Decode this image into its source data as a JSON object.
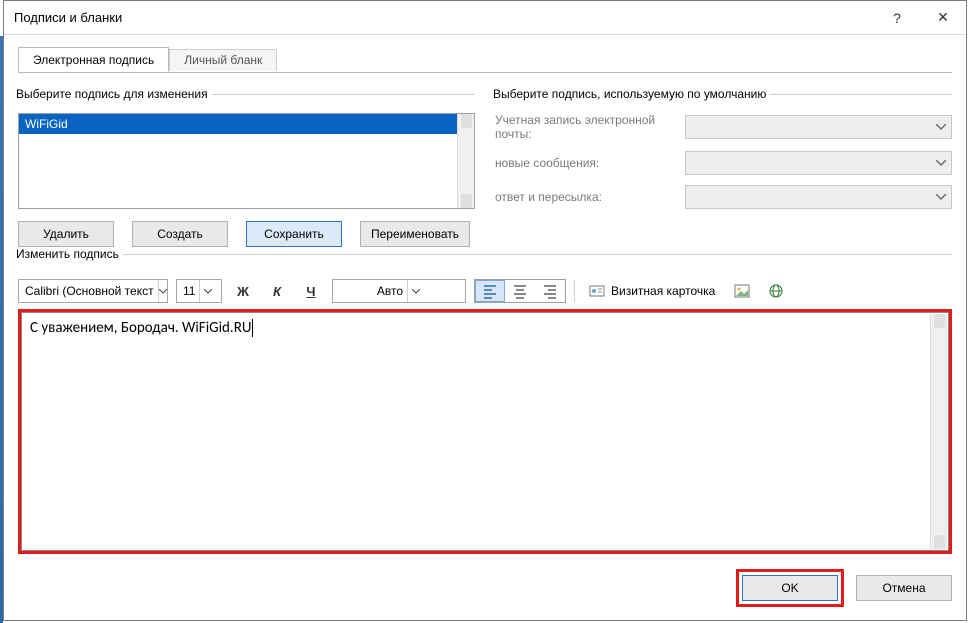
{
  "window": {
    "title": "Подписи и бланки",
    "help_icon": "?",
    "close_icon": "✕"
  },
  "tabs": {
    "active": "Электронная подпись",
    "inactive": "Личный бланк"
  },
  "left": {
    "legend": "Выберите подпись для изменения",
    "list_item": "WiFiGid",
    "buttons": {
      "delete": "Удалить",
      "create": "Создать",
      "save": "Сохранить",
      "rename": "Переименовать"
    }
  },
  "right": {
    "legend": "Выберите подпись, используемую по умолчанию",
    "labels": {
      "account": "Учетная запись электронной почты:",
      "new_msg": "новые сообщения:",
      "reply": "ответ и пересылка:"
    }
  },
  "edit": {
    "legend": "Изменить подпись",
    "font_name": "Calibri (Основной текст",
    "font_size": "11",
    "bold": "Ж",
    "italic": "К",
    "underline": "Ч",
    "color_auto": "Авто",
    "card_label": "Визитная карточка",
    "content": "С уважением, Бородач. WiFiGid.RU"
  },
  "footer": {
    "ok": "OK",
    "cancel": "Отмена"
  }
}
